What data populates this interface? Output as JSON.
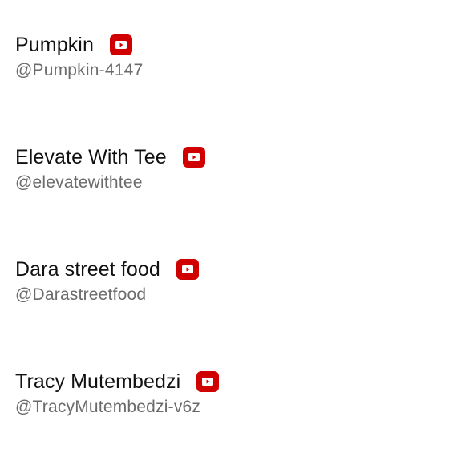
{
  "channels": [
    {
      "name": "Pumpkin",
      "handle": "@Pumpkin-4147",
      "badge_icon": "youtube-icon"
    },
    {
      "name": "Elevate With Tee",
      "handle": "@elevatewithtee",
      "badge_icon": "youtube-icon"
    },
    {
      "name": "Dara street food",
      "handle": "@Darastreetfood",
      "badge_icon": "youtube-icon"
    },
    {
      "name": "Tracy Mutembedzi",
      "handle": "@TracyMutembedzi-v6z",
      "badge_icon": "youtube-icon"
    }
  ],
  "colors": {
    "badge_red": "#d00000",
    "name_text": "#111111",
    "handle_text": "#6b6b6b",
    "background": "#ffffff"
  }
}
